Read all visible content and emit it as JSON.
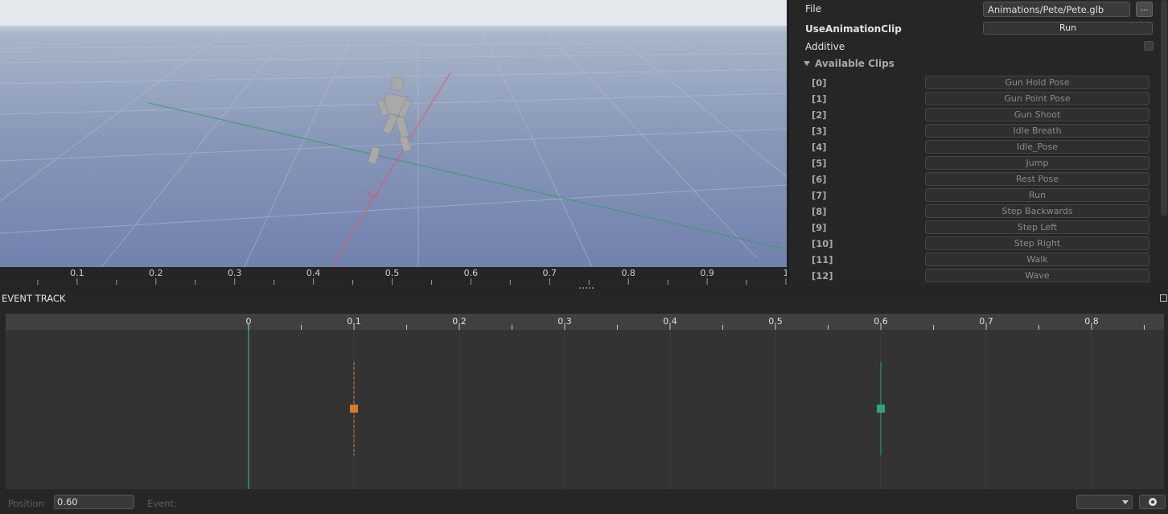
{
  "inspector": {
    "file_label": "File",
    "file_value": "Animations/Pete/Pete.glb",
    "file_browse": "...",
    "use_clip_label": "UseAnimationClip",
    "run_label": "Run",
    "additive_label": "Additive",
    "additive_checked": false,
    "clips_header": "Available Clips",
    "clips": [
      {
        "index": "[0]",
        "name": "Gun Hold Pose"
      },
      {
        "index": "[1]",
        "name": "Gun Point Pose"
      },
      {
        "index": "[2]",
        "name": "Gun Shoot"
      },
      {
        "index": "[3]",
        "name": "Idle Breath"
      },
      {
        "index": "[4]",
        "name": "Idle_Pose"
      },
      {
        "index": "[5]",
        "name": "Jump"
      },
      {
        "index": "[6]",
        "name": "Rest Pose"
      },
      {
        "index": "[7]",
        "name": "Run"
      },
      {
        "index": "[8]",
        "name": "Step Backwards"
      },
      {
        "index": "[9]",
        "name": "Step Left"
      },
      {
        "index": "[10]",
        "name": "Step Right"
      },
      {
        "index": "[11]",
        "name": "Walk"
      },
      {
        "index": "[12]",
        "name": "Wave"
      }
    ]
  },
  "scene_timeline": {
    "labels": [
      "0.1",
      "0.2",
      "0.3",
      "0.4",
      "0.5",
      "0.6",
      "0.7",
      "0.8",
      "0.9",
      "1"
    ]
  },
  "event_track": {
    "title": "EVENT TRACK",
    "ruler_labels": [
      "0",
      "0.1",
      "0.2",
      "0.3",
      "0.4",
      "0.5",
      "0.6",
      "0.7",
      "0.8"
    ],
    "playhead": 0.0,
    "events": [
      {
        "time": 0.1,
        "color": "#d87a2a",
        "style": "dashed"
      },
      {
        "time": 0.6,
        "color": "#2fa47e",
        "style": "solid"
      }
    ],
    "colors": {
      "playhead": "#3fbf9a"
    }
  },
  "footer": {
    "position_label": "Position",
    "position_value": "0.60",
    "event_label": "Event:",
    "event_select_value": ""
  }
}
